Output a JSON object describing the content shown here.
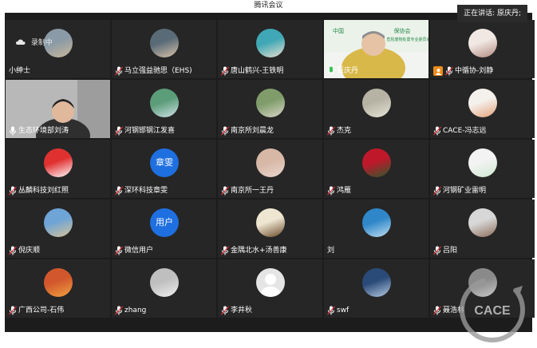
{
  "window": {
    "title": "腾讯会议"
  },
  "speaking": {
    "text": "正在讲话: 原庆丹;"
  },
  "recording": {
    "label": "录制中"
  },
  "watermark": {
    "text": "CACE"
  },
  "participants": [
    {
      "name": "小绅士",
      "avatar": "dog-photo",
      "colors": [
        "#8a9aa6",
        "#c9b79c"
      ]
    },
    {
      "name": "马立强益驰思（EHS)",
      "avatar": "man-portrait",
      "colors": [
        "#5a6b78",
        "#d8c3a8"
      ]
    },
    {
      "name": "唐山鹤兴-王铁明",
      "avatar": "cartoon-photo",
      "colors": [
        "#3fa7b5",
        "#e8e0d0"
      ]
    },
    {
      "name": "原庆丹",
      "video": true,
      "speaking": true,
      "banner_lines": [
        "中国",
        "保协会",
        "危险废物处置专业委员会"
      ]
    },
    {
      "name": "中循协-刘静",
      "avatar": "woman-portrait",
      "host": true,
      "colors": [
        "#f1e8e4",
        "#b18a7e"
      ]
    },
    {
      "name": "生态环境部刘涛",
      "video": true
    },
    {
      "name": "河钢邯钢江发喜",
      "avatar": "lake-photo",
      "colors": [
        "#5b9c79",
        "#cfe1e8"
      ]
    },
    {
      "name": "南京所刘晨龙",
      "avatar": "hiker-photo",
      "colors": [
        "#7f9c6a",
        "#d9d7c8"
      ]
    },
    {
      "name": "杰克",
      "avatar": "pebble-photo",
      "colors": [
        "#b7b3a4",
        "#e7e4d8"
      ]
    },
    {
      "name": "CACE-冯志远",
      "avatar": "cartoon-family",
      "colors": [
        "#f4f0ec",
        "#e4a37a"
      ]
    },
    {
      "name": "丛麟科技刘红照",
      "avatar": "boy-cartoon",
      "colors": [
        "#e03131",
        "#ffffff"
      ]
    },
    {
      "name": "深环科技章雯",
      "avatar_text": "章雯",
      "colors": [
        "#1e6fe0",
        "#1e6fe0"
      ]
    },
    {
      "name": "南京所一王丹",
      "avatar": "cat-photo",
      "colors": [
        "#d7b7a6",
        "#e9d7cc"
      ]
    },
    {
      "name": "鸿雁",
      "avatar": "flower-photo",
      "colors": [
        "#c0182b",
        "#2d5a2d"
      ]
    },
    {
      "name": "河钢矿业雷明",
      "avatar": "girl-cartoon",
      "colors": [
        "#f3f3f3",
        "#cde8d0"
      ]
    },
    {
      "name": "倪庆顺",
      "avatar": "beach-photo",
      "colors": [
        "#6ea4d6",
        "#d8c39a"
      ]
    },
    {
      "name": "微信用户",
      "avatar_text": "用户",
      "colors": [
        "#1e6fe0",
        "#1e6fe0"
      ]
    },
    {
      "name": "金隅北水+汤善康",
      "avatar": "calligraphy",
      "colors": [
        "#efe6d2",
        "#6a4a2a"
      ]
    },
    {
      "name": "刘",
      "avatar": "sea-photo",
      "colors": [
        "#2f86c8",
        "#bfe0f2"
      ]
    },
    {
      "name": "吕阳",
      "avatar": "rabbit-cartoon",
      "colors": [
        "#d7d7d7",
        "#8e6d5a"
      ]
    },
    {
      "name": "广西公司-石伟",
      "avatar": "autumn-photo",
      "colors": [
        "#d2572d",
        "#f0a340"
      ]
    },
    {
      "name": "zhang",
      "avatar": "dog-white",
      "colors": [
        "#bfbfbf",
        "#efefef"
      ]
    },
    {
      "name": "李井秋",
      "avatar": "default-user",
      "colors": [
        "#d9d9d9",
        "#ffffff"
      ]
    },
    {
      "name": "swf",
      "avatar": "pier-photo",
      "colors": [
        "#2a4a78",
        "#b5cbe3"
      ]
    },
    {
      "name": "聂浩林",
      "avatar": "city-photo",
      "colors": [
        "#8a8a8a",
        "#c8c8c8"
      ]
    }
  ]
}
